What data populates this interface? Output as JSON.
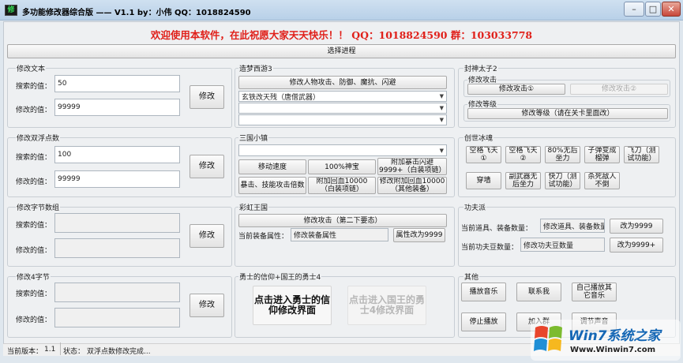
{
  "window": {
    "title": "多功能修改器综合版 —— V1.1 by：小伟 QQ：1018824590",
    "icon_text": "修"
  },
  "welcome": "欢迎使用本软件，在此祝愿大家天天快乐！！ QQ：1018824590  群：103033778",
  "select_process": "选择进程",
  "modify_text": {
    "title": "修改文本",
    "search_label": "搜索的值：",
    "search_value": "50",
    "modify_label": "修改的值：",
    "modify_value": "99999",
    "button": "修改"
  },
  "modify_float": {
    "title": "修改双浮点数",
    "search_label": "搜索的值：",
    "search_value": "100",
    "modify_label": "修改的值：",
    "modify_value": "99999",
    "button": "修改"
  },
  "modify_bytes": {
    "title": "修改字节数组",
    "search_label": "搜索的值：",
    "search_value": "",
    "modify_label": "修改的值：",
    "modify_value": "",
    "button": "修改"
  },
  "modify_4byte": {
    "title": "修改4字节",
    "search_label": "搜索的值：",
    "search_value": "",
    "modify_label": "修改的值：",
    "modify_value": "",
    "button": "修改"
  },
  "zaomeng": {
    "title": "造梦西游3",
    "button": "修改人物攻击、防御、魔抗、闪避",
    "combo1": "玄铁改天残（唐僧武器）",
    "combo2": "",
    "combo3": ""
  },
  "sanguo": {
    "title": "三国小镇",
    "combo": "",
    "buttons": [
      "移动速度",
      "100%神宝",
      "附加暴击闪避9999+（白装项链）",
      "暴击、技能攻击倍数",
      "附加回血10000（白装项链）",
      "修改附加回血10000（其他装备）"
    ]
  },
  "caihong": {
    "title": "彩虹王国",
    "button": "修改攻击（第二下要态）",
    "attr_label": "当前装备属性：",
    "attr_value": "修改装备属性",
    "attr_button": "属性改为9999"
  },
  "warrior": {
    "title": "勇士的信仰+国王的勇士4",
    "btn1": "点击进入勇士的信仰修改界面",
    "btn2": "点击进入国王的勇士4修改界面"
  },
  "fengshen": {
    "title": "封神太子2",
    "attack_title": "修改攻击",
    "attack1": "修改攻击①",
    "attack2": "修改攻击②",
    "level_title": "修改等级",
    "level_button": "修改等级（请在关卡里面改）"
  },
  "chuangshi": {
    "title": "创世冰魂",
    "buttons": [
      "空格飞天①",
      "空格飞天②",
      "80%无后坐力",
      "子弹变成榴弹",
      "飞刀（测试功能）",
      "穿墙",
      "副武器无后坐力",
      "快刀（测试功能）",
      "杀死敌人不倒"
    ]
  },
  "kungfu": {
    "title": "功夫派",
    "items_label": "当前道具、装备数量：",
    "items_value": "修改道具、装备数量",
    "items_button": "改为9999",
    "beans_label": "当前功夫豆数量：",
    "beans_value": "修改功夫豆数量",
    "beans_button": "改为9999+"
  },
  "other": {
    "title": "其他",
    "buttons": [
      "播放音乐",
      "联系我",
      "自己播放其它音乐",
      "停止播放",
      "加入群",
      "调节声音"
    ]
  },
  "status": {
    "version_label": "当前版本：",
    "version": "1.1",
    "state_label": "状态：",
    "state": "双浮点数修改完成..."
  },
  "watermark": {
    "brand": "Win7系统之家",
    "url": "Www.Winwin7.com"
  },
  "colors": {
    "welcome": "#e0201a",
    "client_bg": "#eef0f2"
  }
}
